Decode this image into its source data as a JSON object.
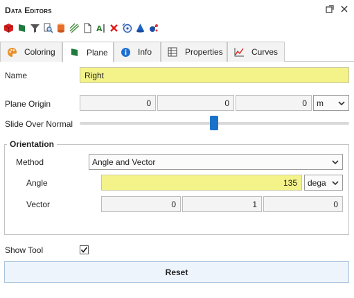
{
  "title": "Data Editors",
  "toolbar_icons": [
    "cube-red-icon",
    "flag-green-icon",
    "funnel-icon",
    "search-doc-icon",
    "cylinder-icon",
    "stripes-icon",
    "document-icon",
    "text-edit-icon",
    "delete-icon",
    "circle-target-icon",
    "cone-icon",
    "molecule-icon"
  ],
  "tabs": [
    {
      "label": "Coloring",
      "icon": "palette-icon"
    },
    {
      "label": "Plane",
      "icon": "flag-icon"
    },
    {
      "label": "Info",
      "icon": "info-icon"
    },
    {
      "label": "Properties",
      "icon": "grid-icon"
    },
    {
      "label": "Curves",
      "icon": "chart-icon"
    }
  ],
  "active_tab": "Plane",
  "name": {
    "label": "Name",
    "value": "Right"
  },
  "plane_origin": {
    "label": "Plane Origin",
    "x": "0",
    "y": "0",
    "z": "0",
    "unit": "m"
  },
  "slide_over_normal": {
    "label": "Slide Over Normal",
    "value_fraction": 0.5
  },
  "orientation": {
    "title": "Orientation",
    "method_label": "Method",
    "method_value": "Angle and Vector",
    "angle_label": "Angle",
    "angle_value": "135",
    "angle_unit": "dega",
    "vector_label": "Vector",
    "vector": [
      "0",
      "1",
      "0"
    ]
  },
  "show_tool": {
    "label": "Show Tool",
    "checked": true
  },
  "reset_label": "Reset"
}
